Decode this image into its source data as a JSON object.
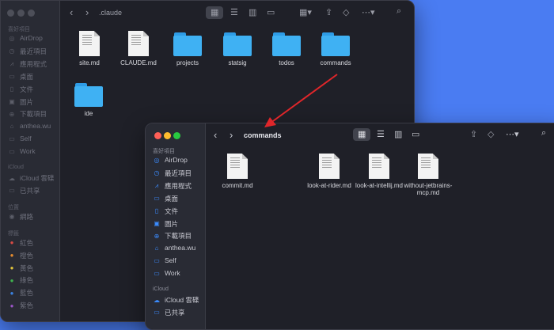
{
  "back_window": {
    "title": ".claude",
    "sidebar": {
      "favorites_header": "喜好項目",
      "favorites": [
        {
          "icon": "airdrop-icon",
          "glyph": "◎",
          "label": "AirDrop"
        },
        {
          "icon": "recents-icon",
          "glyph": "◷",
          "label": "最近項目"
        },
        {
          "icon": "applications-icon",
          "glyph": "⩘",
          "label": "應用程式"
        },
        {
          "icon": "desktop-icon",
          "glyph": "▭",
          "label": "桌面"
        },
        {
          "icon": "documents-icon",
          "glyph": "▯",
          "label": "文件"
        },
        {
          "icon": "pictures-icon",
          "glyph": "▣",
          "label": "圖片"
        },
        {
          "icon": "downloads-icon",
          "glyph": "⊕",
          "label": "下載項目"
        },
        {
          "icon": "home-icon",
          "glyph": "⌂",
          "label": "anthea.wu"
        },
        {
          "icon": "folder-icon",
          "glyph": "▭",
          "label": "Self"
        },
        {
          "icon": "folder-icon",
          "glyph": "▭",
          "label": "Work"
        }
      ],
      "icloud_header": "iCloud",
      "icloud": [
        {
          "icon": "icloud-icon",
          "glyph": "☁",
          "label": "iCloud 雲碟"
        },
        {
          "icon": "shared-icon",
          "glyph": "▭",
          "label": "已共享"
        }
      ],
      "locations_header": "位置",
      "locations": [
        {
          "icon": "network-icon",
          "glyph": "◉",
          "label": "網路"
        }
      ],
      "tags_header": "標籤",
      "tags": [
        {
          "label": "紅色",
          "color": "#d94b45"
        },
        {
          "label": "橙色",
          "color": "#e38b2f"
        },
        {
          "label": "黃色",
          "color": "#e0c23a"
        },
        {
          "label": "綠色",
          "color": "#3fb34f"
        },
        {
          "label": "藍色",
          "color": "#3b82e0"
        },
        {
          "label": "紫色",
          "color": "#9a55c6"
        }
      ]
    },
    "items": [
      {
        "kind": "doc",
        "name": "site.md"
      },
      {
        "kind": "doc",
        "name": "CLAUDE.md"
      },
      {
        "kind": "folder",
        "name": "projects"
      },
      {
        "kind": "folder",
        "name": "statsig"
      },
      {
        "kind": "folder",
        "name": "todos"
      },
      {
        "kind": "folder",
        "name": "commands"
      },
      {
        "kind": "folder",
        "name": "ide"
      }
    ]
  },
  "front_window": {
    "title": "commands",
    "sidebar": {
      "favorites_header": "喜好項目",
      "favorites": [
        {
          "icon": "airdrop-icon",
          "glyph": "◎",
          "label": "AirDrop"
        },
        {
          "icon": "recents-icon",
          "glyph": "◷",
          "label": "最近項目"
        },
        {
          "icon": "applications-icon",
          "glyph": "⩘",
          "label": "應用程式"
        },
        {
          "icon": "desktop-icon",
          "glyph": "▭",
          "label": "桌面"
        },
        {
          "icon": "documents-icon",
          "glyph": "▯",
          "label": "文件"
        },
        {
          "icon": "pictures-icon",
          "glyph": "▣",
          "label": "圖片"
        },
        {
          "icon": "downloads-icon",
          "glyph": "⊕",
          "label": "下載項目"
        },
        {
          "icon": "home-icon",
          "glyph": "⌂",
          "label": "anthea.wu"
        },
        {
          "icon": "folder-icon",
          "glyph": "▭",
          "label": "Self"
        },
        {
          "icon": "folder-icon",
          "glyph": "▭",
          "label": "Work"
        }
      ],
      "icloud_header": "iCloud",
      "icloud": [
        {
          "icon": "icloud-icon",
          "glyph": "☁",
          "label": "iCloud 雲碟"
        },
        {
          "icon": "shared-icon",
          "glyph": "▭",
          "label": "已共享"
        }
      ]
    },
    "items": [
      {
        "kind": "doc",
        "name": "commit.md"
      },
      {
        "kind": "doc",
        "name": "look-at-rider.md"
      },
      {
        "kind": "doc",
        "name": "look-at-intellij.md"
      },
      {
        "kind": "doc",
        "name": "without-jetbrains-mcp.md"
      }
    ]
  },
  "colors": {
    "desktop": "#4a7cf2",
    "window": "#1f2028",
    "sidebar": "#292b34",
    "folder": "#3fb1f3",
    "arrow": "#e0262a"
  }
}
